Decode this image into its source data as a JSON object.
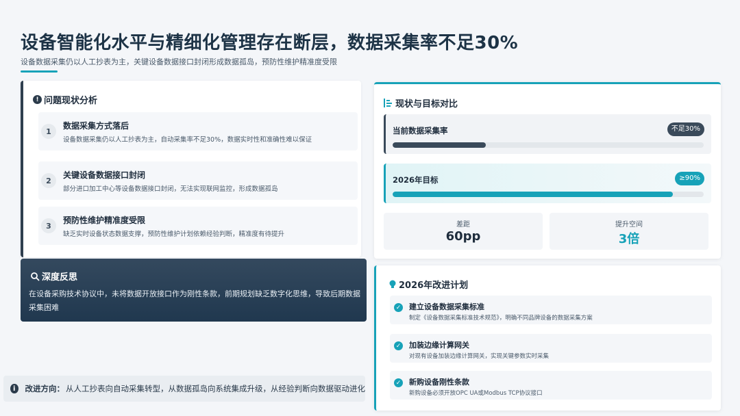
{
  "header": {
    "title": "设备智能化水平与精细化管理存在断层，数据采集率不足30%",
    "subtitle": "设备数据采集仍以人工抄表为主，关键设备数据接口封闭形成数据孤岛，预防性维护精准度受限"
  },
  "problems": {
    "heading": "问题现状分析",
    "items": [
      {
        "num": "1",
        "title": "数据采集方式落后",
        "desc": "设备数据采集仍以人工抄表为主，自动采集率不足30%，数据实时性和准确性难以保证"
      },
      {
        "num": "2",
        "title": "关键设备数据接口封闭",
        "desc": "部分进口加工中心等设备数据接口封闭，无法实现联网监控，形成数据孤岛"
      },
      {
        "num": "3",
        "title": "预防性维护精准度受限",
        "desc": "缺乏实时设备状态数据支撑，预防性维护计划依赖经验判断，精准度有待提升"
      }
    ]
  },
  "reflection": {
    "heading": "深度反思",
    "text": "在设备采购技术协议中，未将数据开放接口作为刚性条款，前期规划缺乏数字化思维，导致后期数据采集困难"
  },
  "direction": {
    "label": "改进方向：",
    "text": "从人工抄表向自动采集转型，从数据孤岛向系统集成升级，从经验判断向数据驱动进化"
  },
  "comparison": {
    "heading": "现状与目标对比",
    "current": {
      "label": "当前数据采集率",
      "badge": "不足30%",
      "level_percent": 30
    },
    "target": {
      "label": "2026年目标",
      "badge": "≥90%",
      "level_percent": 90
    },
    "gap": {
      "label": "差距",
      "value": "60pp"
    },
    "room": {
      "label": "提升空间",
      "value": "3倍"
    }
  },
  "plan": {
    "heading": "2026年改进计划",
    "items": [
      {
        "title": "建立设备数据采集标准",
        "desc": "制定《设备数据采集标准技术规范》，明确不同品牌设备的数据采集方案"
      },
      {
        "title": "加装边缘计算网关",
        "desc": "对现有设备加装边缘计算网关，实现关键参数实时采集"
      },
      {
        "title": "新购设备刚性条款",
        "desc": "新购设备必须开放OPC UA或Modbus TCP协议接口"
      }
    ]
  },
  "colors": {
    "accent": "#17a2b8",
    "dark": "#2f3f4f"
  }
}
